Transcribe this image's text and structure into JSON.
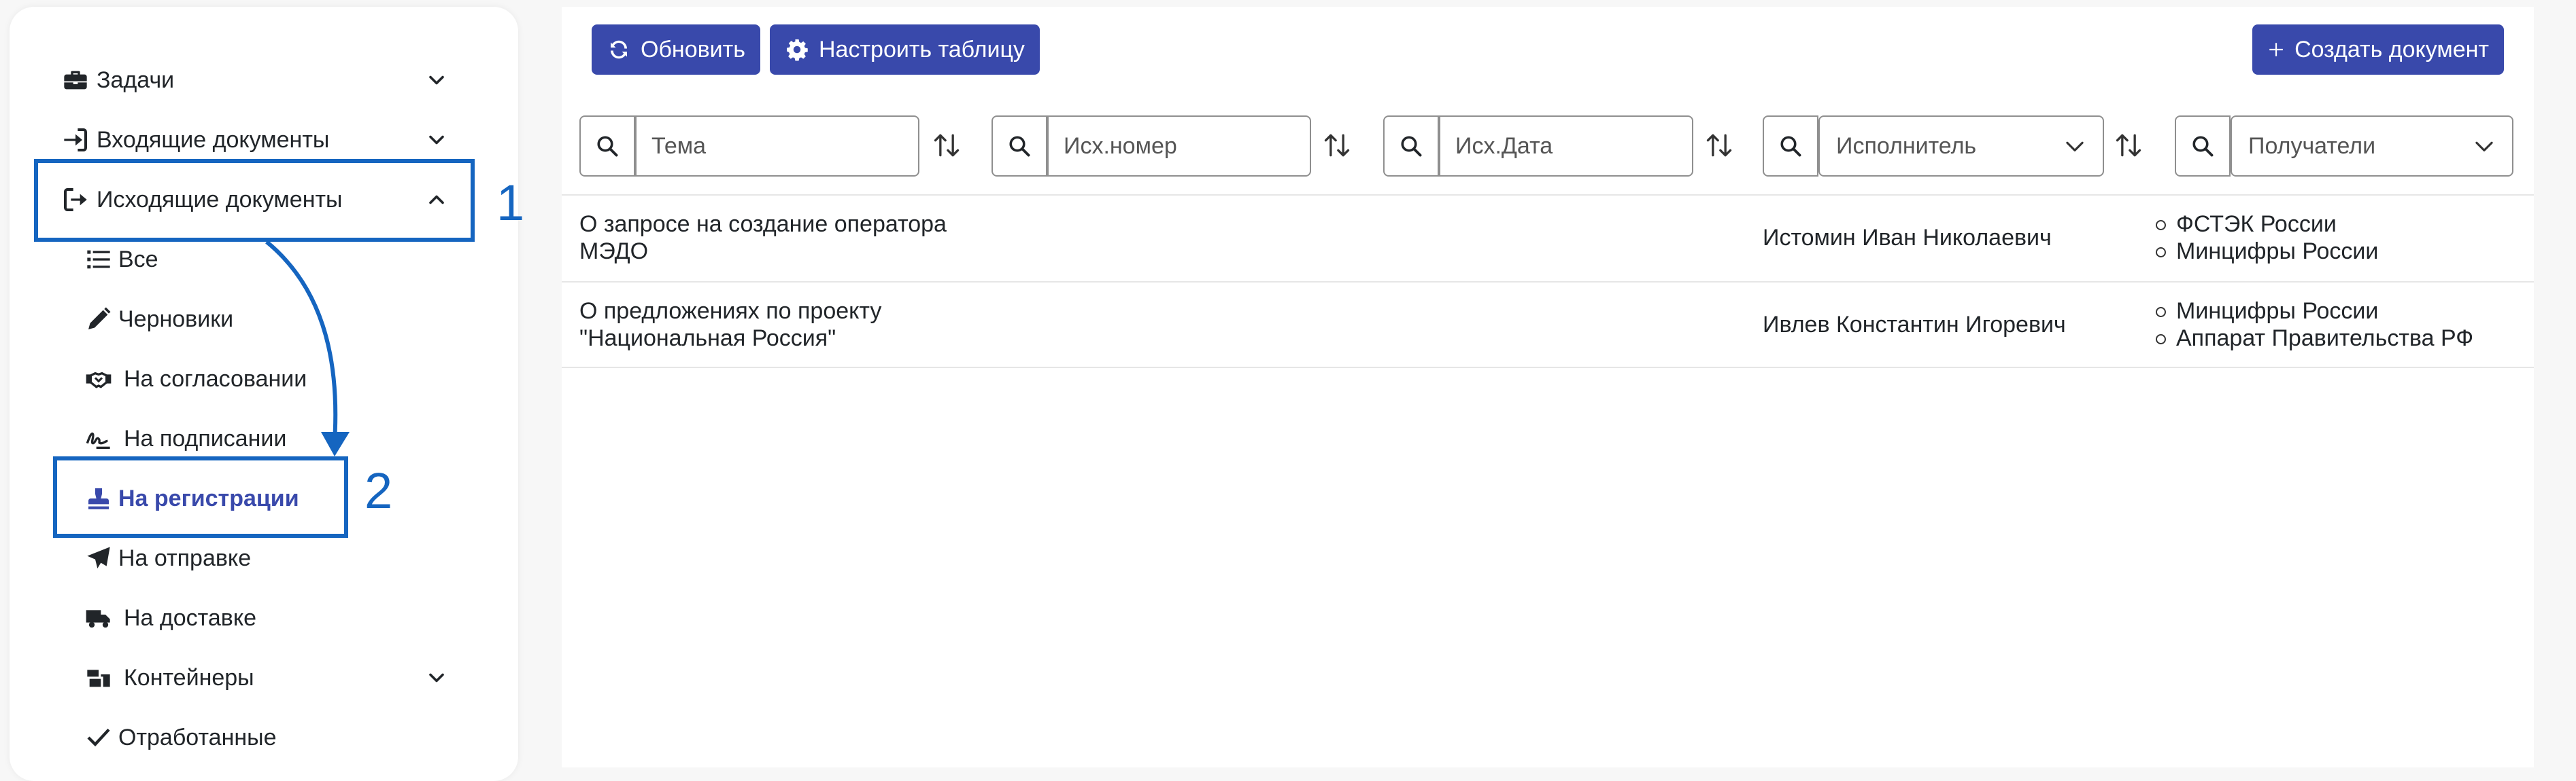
{
  "sidebar": {
    "items": [
      {
        "label": "Задачи",
        "icon": "briefcase-icon"
      },
      {
        "label": "Входящие документы",
        "icon": "sign-in-icon"
      },
      {
        "label": "Исходящие документы",
        "icon": "sign-out-icon"
      },
      {
        "label": "Все",
        "icon": "list-icon"
      },
      {
        "label": "Черновики",
        "icon": "pencil-icon"
      },
      {
        "label": "На согласовании",
        "icon": "handshake-icon"
      },
      {
        "label": "На подписании",
        "icon": "signature-icon"
      },
      {
        "label": "На регистрации",
        "icon": "stamp-icon"
      },
      {
        "label": "На отправке",
        "icon": "paper-plane-icon"
      },
      {
        "label": "На доставке",
        "icon": "truck-icon"
      },
      {
        "label": "Контейнеры",
        "icon": "boxes-icon"
      },
      {
        "label": "Отработанные",
        "icon": "check-icon"
      }
    ]
  },
  "toolbar": {
    "refresh_label": "Обновить",
    "configure_label": "Настроить таблицу",
    "create_label": "Создать документ"
  },
  "filters": {
    "subject_placeholder": "Тема",
    "number_placeholder": "Исх.номер",
    "date_placeholder": "Исх.Дата",
    "executor_placeholder": "Исполнитель",
    "recipients_placeholder": "Получатели"
  },
  "rows": [
    {
      "subject_line1": "О запросе на создание оператора",
      "subject_line2": "МЭДО",
      "executor": "Истомин Иван Николаевич",
      "recipients": [
        "ФСТЭК России",
        "Минцифры России"
      ]
    },
    {
      "subject_line1": "О предложениях по проекту",
      "subject_line2": "\"Национальная Россия\"",
      "executor": "Ивлев Константин Игоревич",
      "recipients": [
        "Минцифры России",
        "Аппарат Правительства РФ"
      ]
    }
  ],
  "annotations": {
    "step1": "1",
    "step2": "2"
  },
  "colors": {
    "accent": "#3949ab",
    "annotation": "#1565c0"
  }
}
